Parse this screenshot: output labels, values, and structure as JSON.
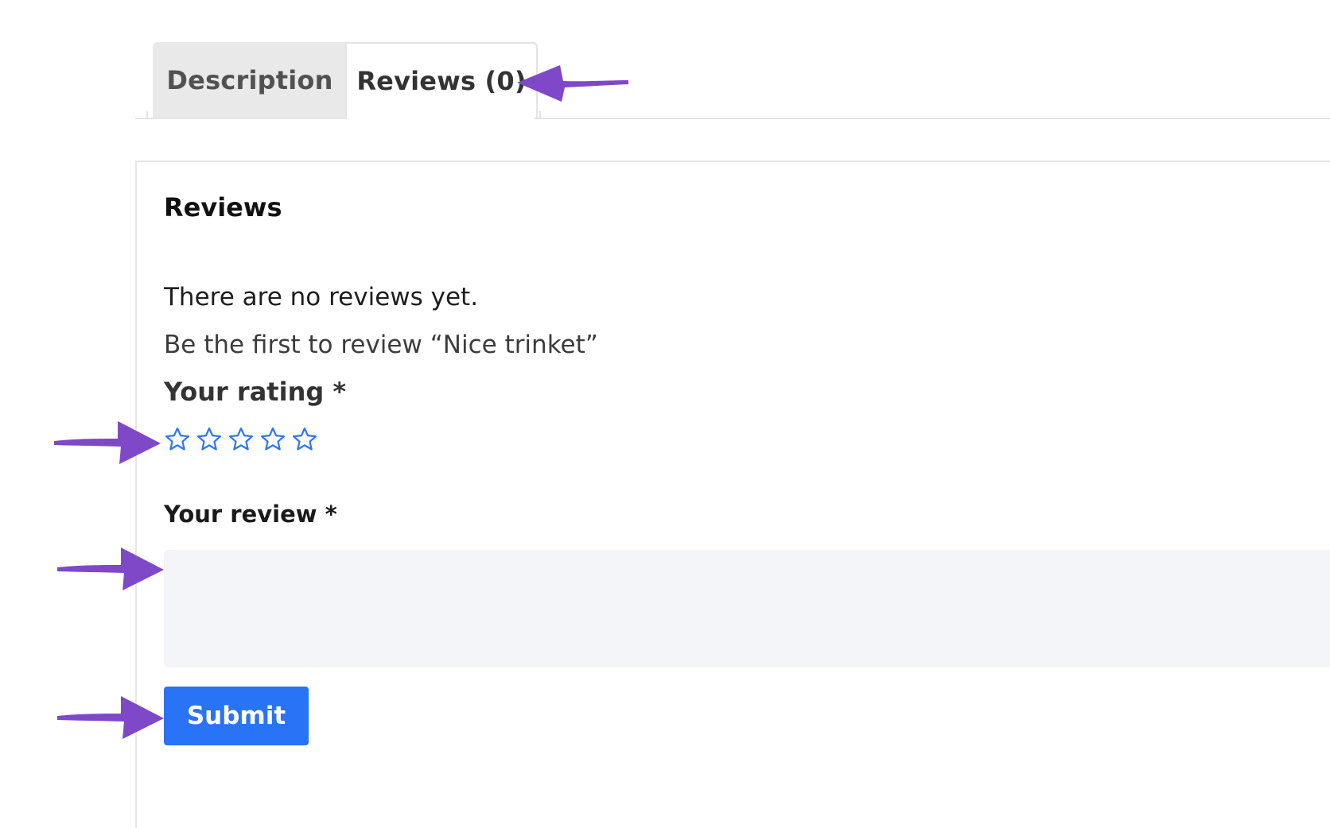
{
  "tabs": [
    {
      "label": "Description",
      "active": false
    },
    {
      "label": "Reviews (0)",
      "active": true
    }
  ],
  "panel": {
    "title": "Reviews",
    "no_reviews_text": "There are no reviews yet.",
    "be_first_text": "Be the first to review “Nice trinket”",
    "rating_label": "Your rating *",
    "rating": {
      "value": 0,
      "max": 5
    },
    "review_label": "Your review *",
    "review_value": "",
    "submit_label": "Submit"
  },
  "colors": {
    "accent": "#2873f6",
    "star": "#2f76f5",
    "annotation_arrow": "#7e48c9",
    "textarea_bg": "#f4f5f8",
    "inactive_tab_bg": "#e9e9ea"
  },
  "icons": {
    "star": "star-outline-icon",
    "arrow": "annotation-arrow-icon"
  }
}
